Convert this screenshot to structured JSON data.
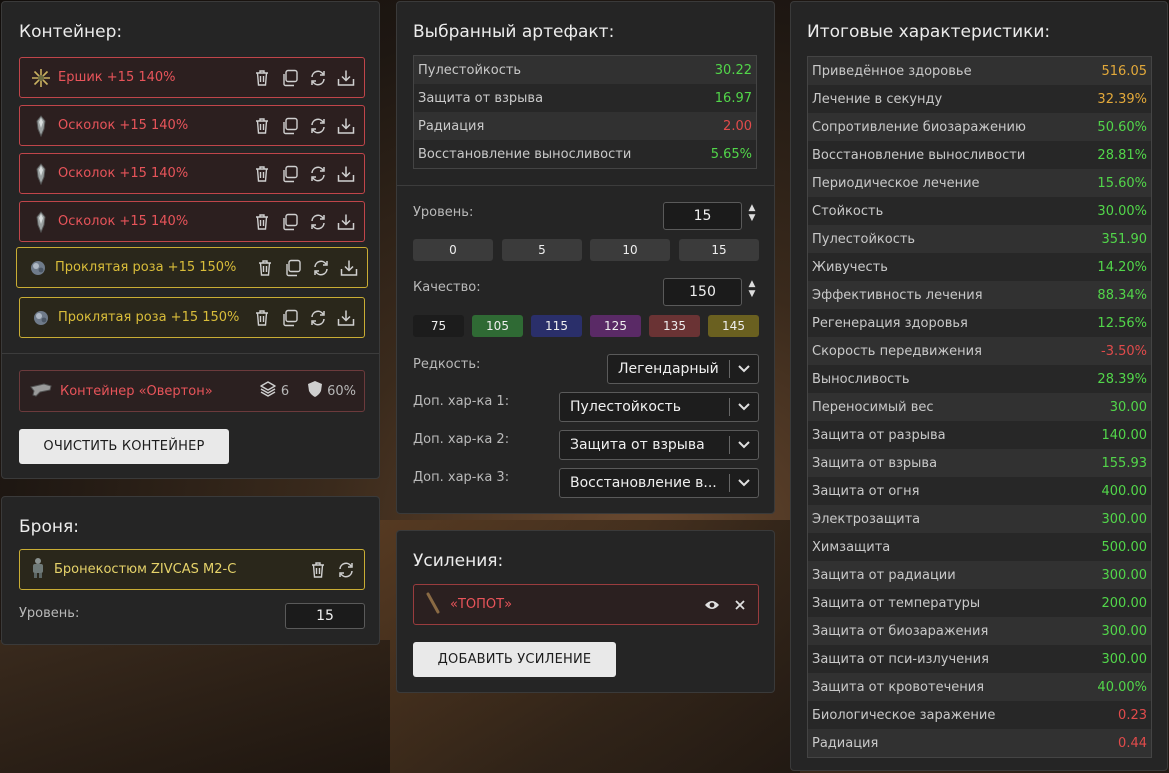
{
  "container": {
    "title": "Контейнер:",
    "artifacts": [
      {
        "name": "Ершик +15 140%",
        "tier": "red",
        "icon": "spiky-artifact-icon"
      },
      {
        "name": "Осколок +15 140%",
        "tier": "red",
        "icon": "shard-artifact-icon"
      },
      {
        "name": "Осколок +15 140%",
        "tier": "red",
        "icon": "shard-artifact-icon"
      },
      {
        "name": "Осколок +15 140%",
        "tier": "red",
        "icon": "shard-artifact-icon"
      },
      {
        "name": "Проклятая роза +15 150%",
        "tier": "gold",
        "icon": "rose-artifact-icon"
      },
      {
        "name": "Проклятая роза +15 150%",
        "tier": "gold",
        "icon": "rose-artifact-icon"
      }
    ],
    "box": {
      "name": "Контейнер «Овертон»",
      "slots": "6",
      "protection": "60%"
    },
    "clear_button": "ОЧИСТИТЬ КОНТЕЙНЕР"
  },
  "armor": {
    "title": "Броня:",
    "name": "Бронекостюм ZIVCAS M2-C",
    "level_label": "Уровень:",
    "level_value": "15"
  },
  "selected": {
    "title": "Выбранный артефакт:",
    "stats": [
      {
        "k": "Пулестойкость",
        "v": "30.22",
        "c": "green"
      },
      {
        "k": "Защита от взрыва",
        "v": "16.97",
        "c": "green"
      },
      {
        "k": "Радиация",
        "v": "2.00",
        "c": "red"
      },
      {
        "k": "Восстановление выносливости",
        "v": "5.65%",
        "c": "green"
      }
    ],
    "level_label": "Уровень:",
    "level_value": "15",
    "level_chips": [
      "0",
      "5",
      "10",
      "15"
    ],
    "quality_label": "Качество:",
    "quality_value": "150",
    "quality_chips": [
      {
        "label": "75",
        "color": "#1c1c1c"
      },
      {
        "label": "105",
        "color": "#2f6a34"
      },
      {
        "label": "115",
        "color": "#2a2f6a"
      },
      {
        "label": "125",
        "color": "#5a2a66"
      },
      {
        "label": "135",
        "color": "#6a3334"
      },
      {
        "label": "145",
        "color": "#6a6020"
      }
    ],
    "rarity_label": "Редкость:",
    "rarity_value": "Легендарный",
    "extra1_label": "Доп. хар-ка 1:",
    "extra1_value": "Пулестойкость",
    "extra2_label": "Доп. хар-ка 2:",
    "extra2_value": "Защита от взрыва",
    "extra3_label": "Доп. хар-ка 3:",
    "extra3_value": "Восстановление в..."
  },
  "boosts": {
    "title": "Усиления:",
    "item": "«ТОПОТ»",
    "add_button": "ДОБАВИТЬ УСИЛЕНИЕ"
  },
  "totals": {
    "title": "Итоговые характеристики:",
    "rows": [
      {
        "k": "Приведённое здоровье",
        "v": "516.05",
        "c": "orange"
      },
      {
        "k": "Лечение в секунду",
        "v": "32.39%",
        "c": "orange"
      },
      {
        "k": "Сопротивление биозаражению",
        "v": "50.60%",
        "c": "green"
      },
      {
        "k": "Восстановление выносливости",
        "v": "28.81%",
        "c": "green"
      },
      {
        "k": "Периодическое лечение",
        "v": "15.60%",
        "c": "green"
      },
      {
        "k": "Стойкость",
        "v": "30.00%",
        "c": "green"
      },
      {
        "k": "Пулестойкость",
        "v": "351.90",
        "c": "green"
      },
      {
        "k": "Живучесть",
        "v": "14.20%",
        "c": "green"
      },
      {
        "k": "Эффективность лечения",
        "v": "88.34%",
        "c": "green"
      },
      {
        "k": "Регенерация здоровья",
        "v": "12.56%",
        "c": "green"
      },
      {
        "k": "Скорость передвижения",
        "v": "-3.50%",
        "c": "red"
      },
      {
        "k": "Выносливость",
        "v": "28.39%",
        "c": "green"
      },
      {
        "k": "Переносимый вес",
        "v": "30.00",
        "c": "green"
      },
      {
        "k": "Защита от разрыва",
        "v": "140.00",
        "c": "green"
      },
      {
        "k": "Защита от взрыва",
        "v": "155.93",
        "c": "green"
      },
      {
        "k": "Защита от огня",
        "v": "400.00",
        "c": "green"
      },
      {
        "k": "Электрозащита",
        "v": "300.00",
        "c": "green"
      },
      {
        "k": "Химзащита",
        "v": "500.00",
        "c": "green"
      },
      {
        "k": "Защита от радиации",
        "v": "300.00",
        "c": "green"
      },
      {
        "k": "Защита от температуры",
        "v": "200.00",
        "c": "green"
      },
      {
        "k": "Защита от биозаражения",
        "v": "300.00",
        "c": "green"
      },
      {
        "k": "Защита от пси-излучения",
        "v": "300.00",
        "c": "green"
      },
      {
        "k": "Защита от кровотечения",
        "v": "40.00%",
        "c": "green"
      },
      {
        "k": "Биологическое заражение",
        "v": "0.23",
        "c": "red"
      },
      {
        "k": "Радиация",
        "v": "0.44",
        "c": "red"
      }
    ]
  }
}
